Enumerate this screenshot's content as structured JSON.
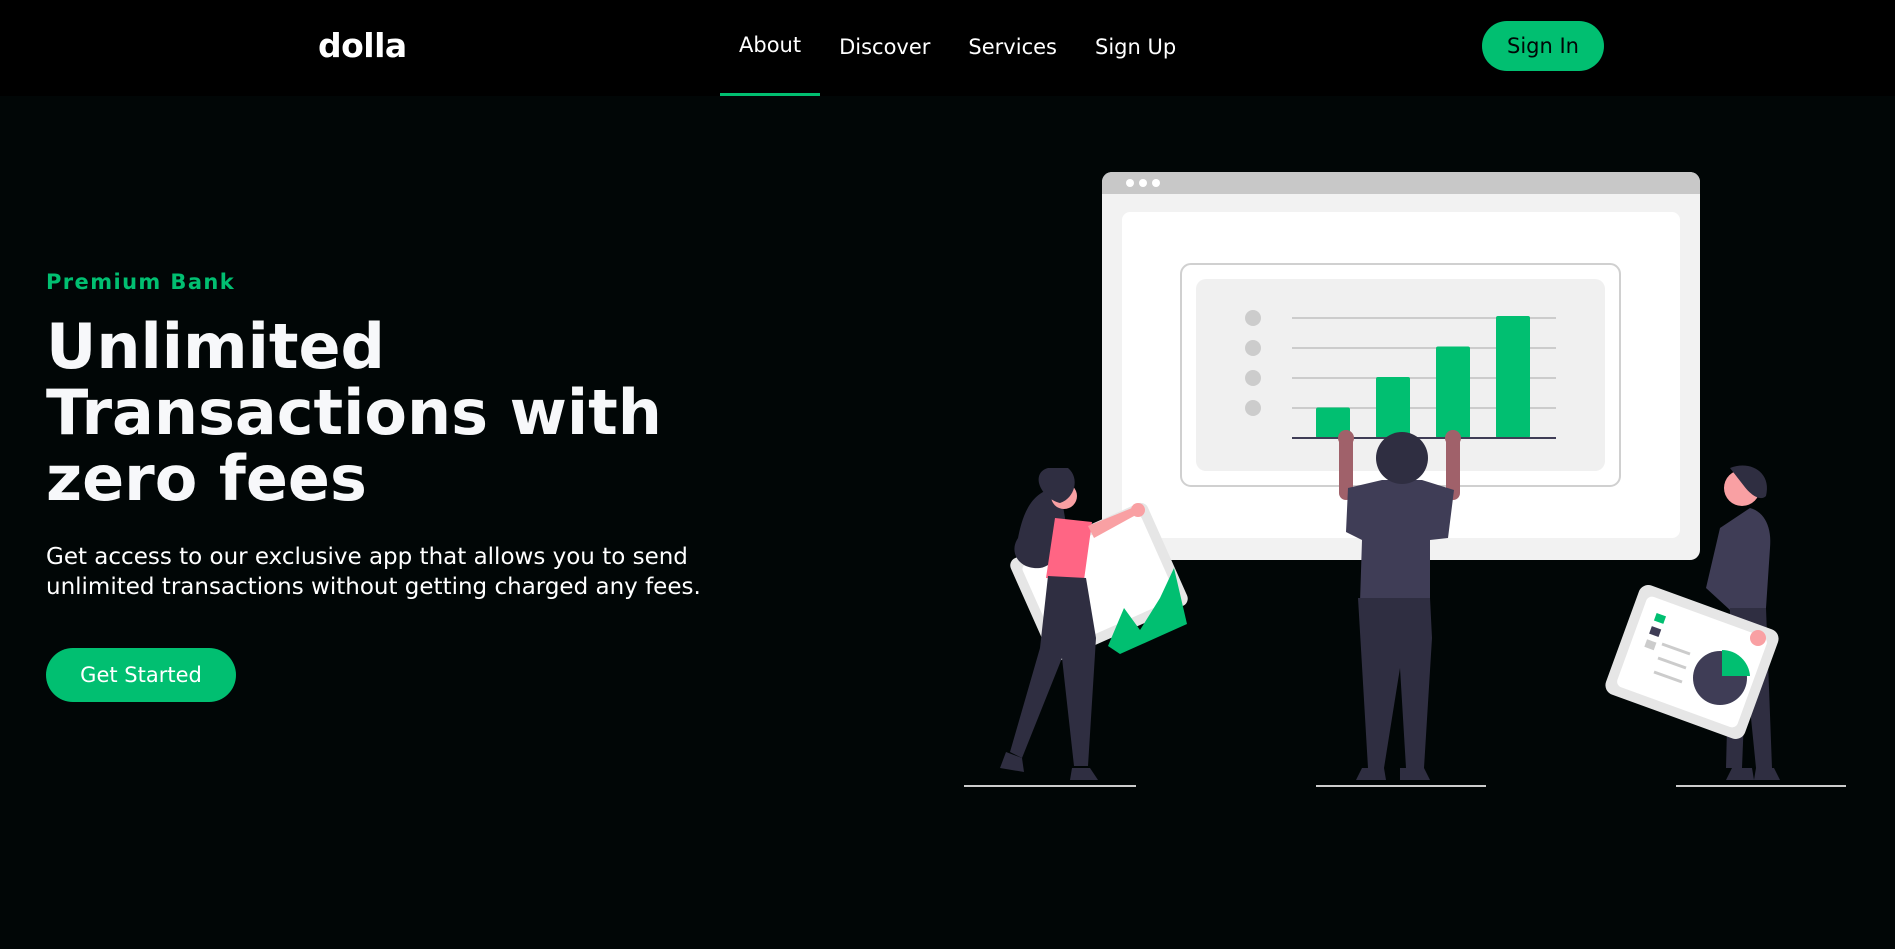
{
  "nav": {
    "logo": "dolla",
    "items": [
      {
        "label": "About",
        "active": true
      },
      {
        "label": "Discover",
        "active": false
      },
      {
        "label": "Services",
        "active": false
      },
      {
        "label": "Sign Up",
        "active": false
      }
    ],
    "signin_label": "Sign In"
  },
  "hero": {
    "topline": "Premium Bank",
    "heading": "Unlimited Transactions with zero fees",
    "subtitle": "Get access to our exclusive app that allows you to send unlimited transactions without getting charged any fees.",
    "cta_label": "Get Started"
  },
  "illustration": {
    "icon": "people-presenting-charts-illustration",
    "bar_chart": {
      "type": "bar",
      "values": [
        1,
        2,
        3,
        4
      ]
    }
  },
  "colors": {
    "accent": "#01bf71",
    "background": "#010606",
    "navbar": "#000000",
    "text": "#ffffff"
  }
}
